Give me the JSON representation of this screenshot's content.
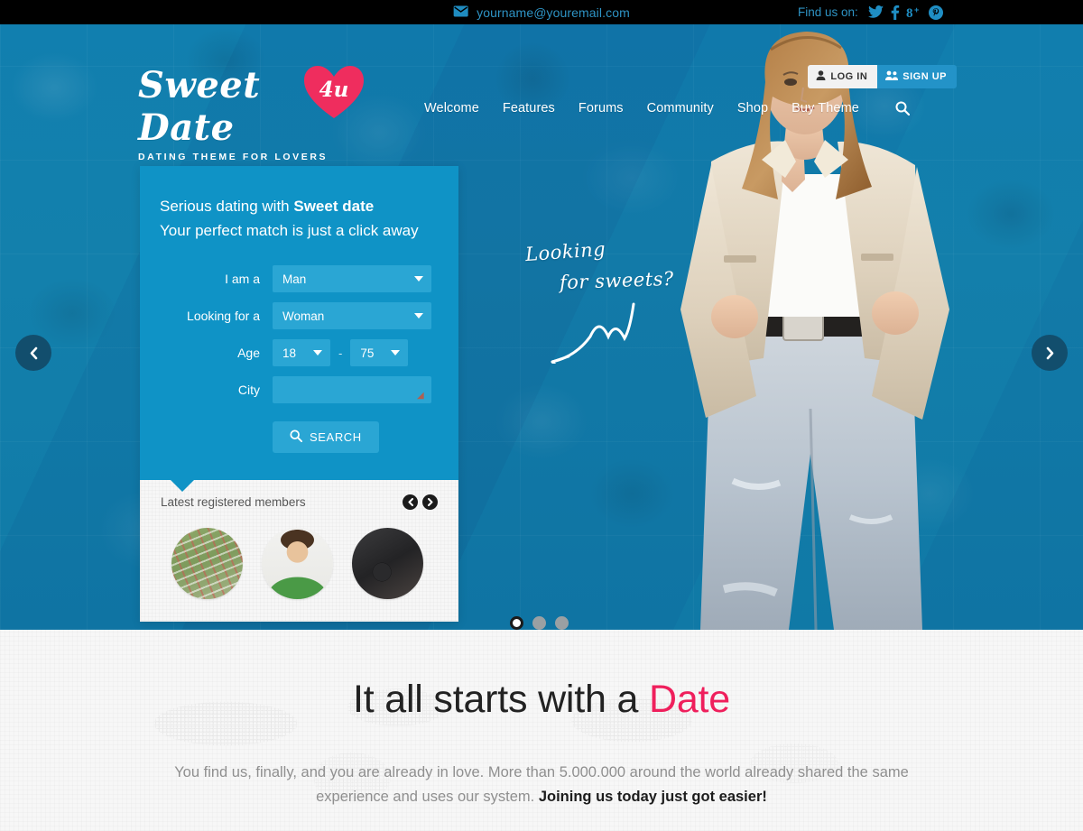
{
  "topbar": {
    "email": "yourname@youremail.com",
    "email_icon": "envelope-icon",
    "find_us_label": "Find us on:",
    "social": [
      {
        "name": "twitter-icon",
        "label": "Twitter"
      },
      {
        "name": "facebook-icon",
        "label": "Facebook"
      },
      {
        "name": "googleplus-icon",
        "label": "Google Plus"
      },
      {
        "name": "pinterest-icon",
        "label": "Pinterest"
      }
    ]
  },
  "header": {
    "logo": {
      "script": "Sweet Date",
      "heart_text": "4u",
      "tagline": "DATING THEME FOR LOVERS",
      "heart_color": "#ef2d5e"
    },
    "nav": [
      {
        "label": "Welcome"
      },
      {
        "label": "Features"
      },
      {
        "label": "Forums"
      },
      {
        "label": "Community"
      },
      {
        "label": "Shop"
      },
      {
        "label": "Buy Theme"
      }
    ],
    "search_icon": "search-icon",
    "login_label": "LOG IN",
    "login_icon": "user-icon",
    "signup_label": "SIGN UP",
    "signup_icon": "users-icon"
  },
  "search_card": {
    "title_prefix": "Serious dating with ",
    "title_strong": "Sweet date",
    "subtitle": "Your perfect match is just a click away",
    "fields": {
      "i_am_a": {
        "label": "I am a",
        "value": "Man",
        "options": [
          "Man",
          "Woman"
        ]
      },
      "looking_for": {
        "label": "Looking for a",
        "value": "Woman",
        "options": [
          "Woman",
          "Man"
        ]
      },
      "age": {
        "label": "Age",
        "min": "18",
        "max": "75",
        "separator": "-"
      },
      "city": {
        "label": "City",
        "value": "",
        "placeholder": ""
      }
    },
    "search_button": "SEARCH",
    "search_button_icon": "search-icon"
  },
  "members": {
    "title": "Latest registered members",
    "prev_icon": "arrow-left-circle-icon",
    "next_icon": "arrow-right-circle-icon",
    "avatars": [
      {
        "name": "member-avatar-1",
        "alt": "aerial field photo"
      },
      {
        "name": "member-avatar-2",
        "alt": "young man in green shirt"
      },
      {
        "name": "member-avatar-3",
        "alt": "dslr camera"
      }
    ]
  },
  "hero": {
    "handwritten_line1": "Looking",
    "handwritten_line2": "for sweets?",
    "prev_arrow_icon": "chevron-left-icon",
    "next_arrow_icon": "chevron-right-icon",
    "slide_dots": [
      {
        "active": true
      },
      {
        "active": false
      },
      {
        "active": false
      }
    ],
    "model_alt": "woman in cream jacket and jeans"
  },
  "lower": {
    "title_plain": "It all starts with a ",
    "title_accent": "Date",
    "accent_color": "#ef1f5c",
    "paragraph_plain": "You find us, finally, and you are already in love. More than 5.000.000 around the world already shared the same experience and uses our system. ",
    "paragraph_strong": "Joining us today just got easier!"
  }
}
